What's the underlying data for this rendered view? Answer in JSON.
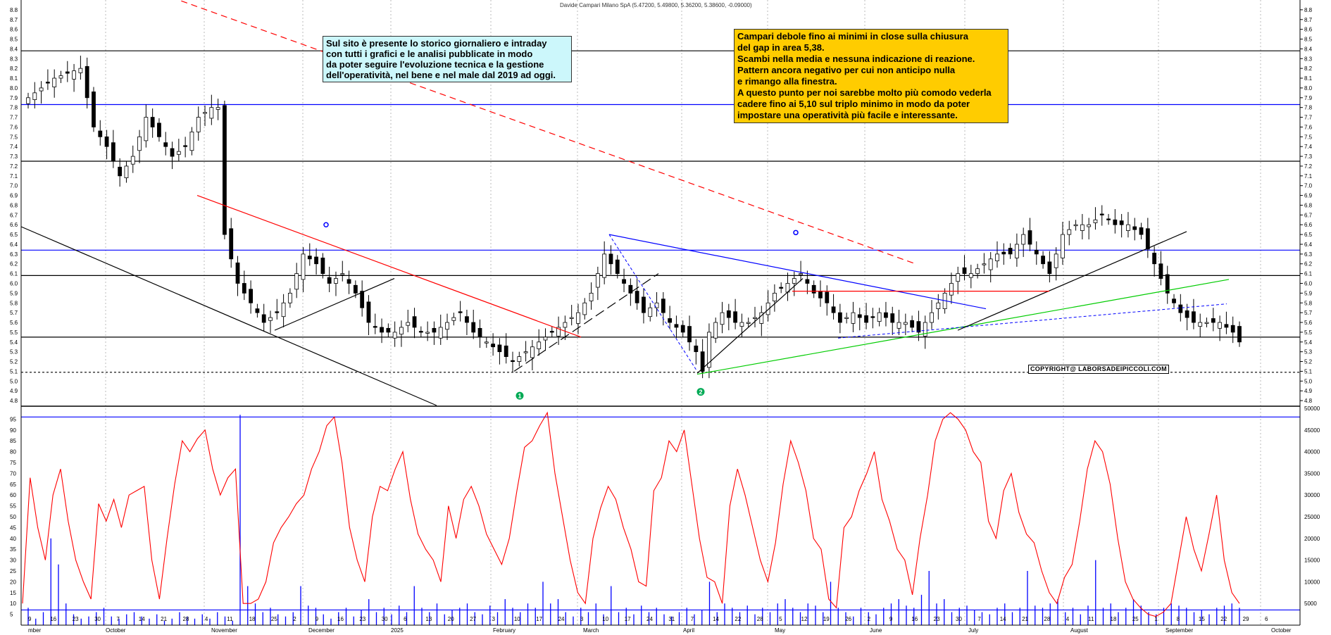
{
  "chart_title": "Davide Campari Milano SpA (5.47200, 5.49800, 5.36200, 5.38600, -0.09000)",
  "annotations": {
    "left_note": "Sul sito è presente lo storico giornaliero e intraday\ncon tutti i grafici e le analisi pubblicate in modo\nda poter seguire l'evoluzione tecnica e la gestione\ndell'operatività, nel bene e nel male dal 2019 ad oggi.",
    "right_note": "Campari debole fino ai minimi in close sulla chiusura\ndel gap in area 5,38.\nScambi nella media e nessuna indicazione di reazione.\nPattern ancora negativo per cui non anticipo nulla\ne rimango alla finestra.\nA questo punto per noi sarebbe molto più comodo vederla\ncadere fino ai 5,10 sul triplo minimo in modo da poter\nimpostare una operatività più facile e interessante.",
    "copyright": "COPYRIGHT@ LABORSADEIPICCOLI.COM",
    "marker_1": "1",
    "marker_2": "2"
  },
  "chart_data": [
    {
      "type": "candlestick",
      "title": "Davide Campari Milano SpA (5.47200, 5.49800, 5.36200, 5.38600, -0.09000)",
      "ylim": [
        4.75,
        8.9
      ],
      "y_ticks": [
        "4.8",
        "4.9",
        "5.0",
        "5.1",
        "5.2",
        "5.3",
        "5.4",
        "5.5",
        "5.6",
        "5.7",
        "5.8",
        "5.9",
        "6.0",
        "6.1",
        "6.2",
        "6.3",
        "6.4",
        "6.5",
        "6.6",
        "6.7",
        "6.8",
        "6.9",
        "7.0",
        "7.1",
        "7.2",
        "7.3",
        "7.4",
        "7.5",
        "7.6",
        "7.7",
        "7.8",
        "7.9",
        "8.0",
        "8.1",
        "8.2",
        "8.3",
        "8.4",
        "8.5",
        "8.6",
        "8.7",
        "8.8"
      ],
      "close_path": [
        [
          0,
          7.9
        ],
        [
          4,
          8.1
        ],
        [
          8,
          8.2
        ],
        [
          10,
          7.6
        ],
        [
          12,
          7.4
        ],
        [
          14,
          7.1
        ],
        [
          16,
          7.3
        ],
        [
          18,
          7.7
        ],
        [
          20,
          7.5
        ],
        [
          22,
          7.3
        ],
        [
          24,
          7.4
        ],
        [
          26,
          7.7
        ],
        [
          28,
          7.8
        ],
        [
          29,
          7.8
        ],
        [
          30,
          6.5
        ],
        [
          32,
          6.0
        ],
        [
          34,
          5.8
        ],
        [
          36,
          5.6
        ],
        [
          38,
          5.7
        ],
        [
          40,
          5.9
        ],
        [
          42,
          6.3
        ],
        [
          44,
          6.2
        ],
        [
          46,
          6.0
        ],
        [
          48,
          6.1
        ],
        [
          50,
          5.9
        ],
        [
          52,
          5.6
        ],
        [
          54,
          5.5
        ],
        [
          56,
          5.5
        ],
        [
          58,
          5.6
        ],
        [
          60,
          5.5
        ],
        [
          62,
          5.5
        ],
        [
          64,
          5.6
        ],
        [
          66,
          5.7
        ],
        [
          68,
          5.5
        ],
        [
          70,
          5.4
        ],
        [
          72,
          5.3
        ],
        [
          74,
          5.2
        ],
        [
          76,
          5.3
        ],
        [
          78,
          5.4
        ],
        [
          80,
          5.5
        ],
        [
          82,
          5.6
        ],
        [
          84,
          5.7
        ],
        [
          86,
          5.9
        ],
        [
          88,
          6.3
        ],
        [
          90,
          6.1
        ],
        [
          92,
          5.9
        ],
        [
          94,
          5.7
        ],
        [
          96,
          5.8
        ],
        [
          98,
          5.6
        ],
        [
          100,
          5.5
        ],
        [
          102,
          5.3
        ],
        [
          103,
          5.1
        ],
        [
          104,
          5.5
        ],
        [
          106,
          5.7
        ],
        [
          108,
          5.6
        ],
        [
          110,
          5.6
        ],
        [
          112,
          5.7
        ],
        [
          114,
          5.9
        ],
        [
          116,
          6.0
        ],
        [
          118,
          6.1
        ],
        [
          120,
          5.9
        ],
        [
          122,
          5.8
        ],
        [
          124,
          5.6
        ],
        [
          126,
          5.7
        ],
        [
          128,
          5.6
        ],
        [
          130,
          5.7
        ],
        [
          132,
          5.6
        ],
        [
          134,
          5.6
        ],
        [
          136,
          5.5
        ],
        [
          138,
          5.7
        ],
        [
          140,
          5.9
        ],
        [
          142,
          6.1
        ],
        [
          144,
          6.1
        ],
        [
          146,
          6.2
        ],
        [
          148,
          6.3
        ],
        [
          150,
          6.3
        ],
        [
          152,
          6.5
        ],
        [
          154,
          6.3
        ],
        [
          156,
          6.1
        ],
        [
          158,
          6.5
        ],
        [
          160,
          6.6
        ],
        [
          162,
          6.6
        ],
        [
          164,
          6.7
        ],
        [
          166,
          6.6
        ],
        [
          168,
          6.6
        ],
        [
          170,
          6.5
        ],
        [
          172,
          6.2
        ],
        [
          174,
          5.9
        ],
        [
          176,
          5.7
        ],
        [
          178,
          5.6
        ],
        [
          180,
          5.6
        ],
        [
          182,
          5.6
        ],
        [
          184,
          5.5
        ],
        [
          185,
          5.4
        ]
      ],
      "horizontal_levels": [
        {
          "y": 8.38,
          "color": "#000000"
        },
        {
          "y": 7.83,
          "color": "#0000ff"
        },
        {
          "y": 7.25,
          "color": "#000000"
        },
        {
          "y": 6.34,
          "color": "#0000ff"
        },
        {
          "y": 6.08,
          "color": "#000000"
        },
        {
          "y": 5.45,
          "color": "#000000"
        },
        {
          "y": 5.09,
          "color": "#000000",
          "dashed": true
        }
      ],
      "x_ticks": [
        "9",
        "16",
        "23",
        "30",
        "7",
        "14",
        "21",
        "28",
        "4",
        "11",
        "18",
        "25",
        "2",
        "9",
        "16",
        "23",
        "30",
        "6",
        "13",
        "20",
        "27",
        "3",
        "10",
        "17",
        "24",
        "3",
        "10",
        "17",
        "24",
        "31",
        "7",
        "14",
        "22",
        "28",
        "5",
        "12",
        "19",
        "26",
        "2",
        "9",
        "16",
        "23",
        "30",
        "7",
        "14",
        "21",
        "28",
        "4",
        "11",
        "18",
        "25",
        "1",
        "8",
        "15",
        "22",
        "29",
        "6"
      ],
      "months": [
        "mber",
        "October",
        "November",
        "December",
        "2025",
        "February",
        "March",
        "April",
        "May",
        "June",
        "July",
        "August",
        "September",
        "October"
      ]
    },
    {
      "type": "line",
      "title": "",
      "ylim": [
        0,
        100
      ],
      "y_ticks_left": [
        "5",
        "10",
        "15",
        "20",
        "25",
        "30",
        "35",
        "40",
        "45",
        "50",
        "55",
        "60",
        "65",
        "70",
        "75",
        "80",
        "85",
        "90",
        "95"
      ],
      "y_ticks_right": [
        "5000",
        "10000",
        "15000",
        "20000",
        "25000",
        "30000",
        "35000",
        "40000",
        "45000",
        "50000"
      ],
      "levels": [
        96,
        7
      ],
      "series": [
        {
          "color": "#ff0000",
          "values": [
            10,
            68,
            45,
            30,
            60,
            72,
            48,
            30,
            20,
            12,
            56,
            48,
            58,
            45,
            60,
            62,
            64,
            30,
            12,
            40,
            65,
            85,
            80,
            86,
            90,
            72,
            60,
            68,
            72,
            10,
            10,
            12,
            20,
            38,
            45,
            50,
            56,
            60,
            72,
            80,
            92,
            96,
            75,
            45,
            30,
            20,
            50,
            64,
            62,
            72,
            80,
            58,
            42,
            35,
            30,
            20,
            55,
            40,
            58,
            64,
            55,
            42,
            35,
            28,
            40,
            62,
            82,
            85,
            92,
            98,
            70,
            50,
            30,
            15,
            10,
            40,
            54,
            64,
            58,
            45,
            35,
            20,
            18,
            62,
            68,
            85,
            80,
            90,
            65,
            40,
            22,
            20,
            10,
            55,
            72,
            60,
            45,
            30,
            20,
            38,
            65,
            85,
            75,
            62,
            40,
            35,
            12,
            8,
            45,
            50,
            62,
            70,
            80,
            58,
            48,
            35,
            30,
            14,
            40,
            60,
            85,
            95,
            98,
            95,
            90,
            80,
            75,
            48,
            40,
            62,
            70,
            52,
            42,
            38,
            25,
            15,
            10,
            22,
            28,
            48,
            72,
            85,
            80,
            65,
            40,
            20,
            12,
            8,
            5,
            4,
            6,
            10,
            30,
            50,
            35,
            25,
            42,
            60,
            30,
            15,
            10
          ]
        },
        {
          "color": "#0000ff",
          "values": [
            8,
            3,
            6,
            40,
            28,
            10,
            5,
            3,
            4,
            6,
            8,
            4,
            3,
            5,
            6,
            4,
            3,
            5,
            2,
            3,
            6,
            4,
            3,
            5,
            3,
            6,
            4,
            2,
            97,
            18,
            10,
            6,
            8,
            5,
            4,
            6,
            18,
            9,
            8,
            5,
            3,
            6,
            8,
            4,
            7,
            12,
            6,
            8,
            5,
            9,
            6,
            18,
            8,
            6,
            10,
            5,
            7,
            8,
            10,
            6,
            5,
            9,
            6,
            12,
            8,
            6,
            10,
            8,
            20,
            10,
            12,
            6,
            4,
            8,
            6,
            10,
            5,
            18,
            6,
            8,
            5,
            9,
            6,
            8,
            5,
            4,
            6,
            8,
            5,
            7,
            20,
            6,
            10,
            8,
            6,
            9,
            5,
            8,
            6,
            10,
            12,
            8,
            6,
            10,
            9,
            6,
            20,
            8,
            6,
            4,
            8,
            6,
            5,
            8,
            10,
            12,
            9,
            8,
            14,
            25,
            10,
            12,
            6,
            8,
            9,
            7,
            6,
            5,
            8,
            10,
            6,
            8,
            25,
            9,
            8,
            10,
            12,
            6,
            8,
            5,
            9,
            30,
            8,
            10,
            6,
            8,
            12,
            9,
            6,
            5,
            8,
            10,
            9,
            8,
            6,
            7,
            5,
            8,
            9,
            10,
            8
          ]
        }
      ]
    }
  ]
}
